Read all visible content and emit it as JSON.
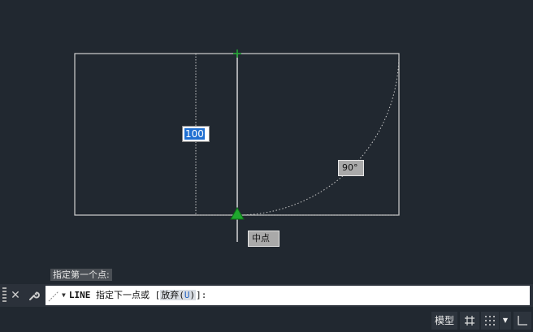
{
  "drawing": {
    "dimension_value": "100",
    "angle_label": "90°",
    "snap_label": "中点"
  },
  "command": {
    "history_prompt": "指定第一个点:",
    "name": "LINE",
    "prompt_text": " 指定下一点或 [",
    "option_label": "放弃",
    "option_key": "U",
    "prompt_tail": "]:",
    "close_glyph": "✕",
    "wrench_glyph": "🔧"
  },
  "statusbar": {
    "model_tab": "模型",
    "grid_glyph": "#",
    "snap_glyph": "⋮⋮",
    "dropdown_glyph": "▼",
    "ortho_glyph": "∟"
  },
  "colors": {
    "background": "#212830",
    "geometry": "#d8d8d8",
    "snap_marker": "#22aa33",
    "selection": "#1f6fd1"
  }
}
